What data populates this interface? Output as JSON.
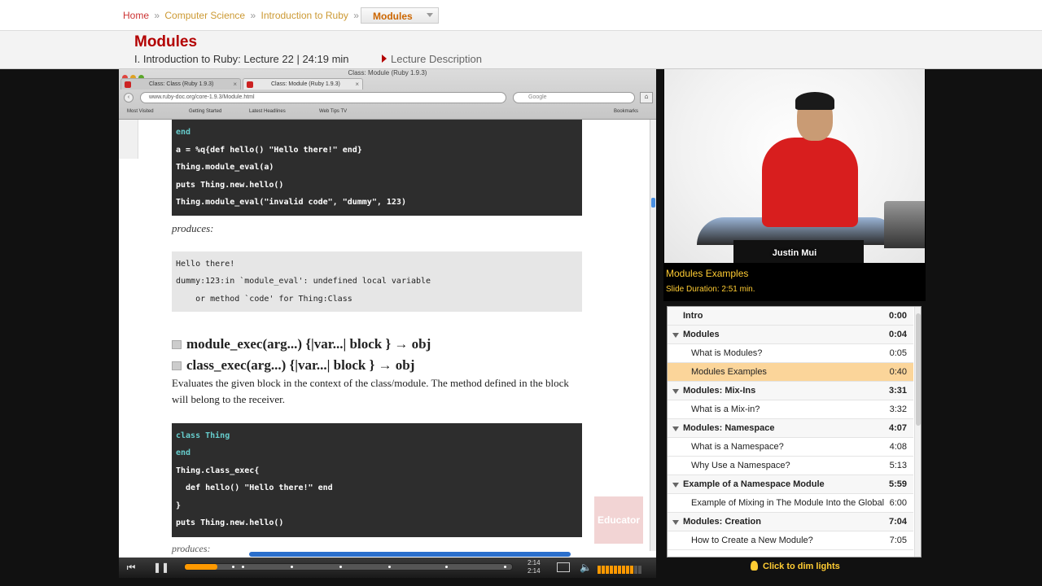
{
  "breadcrumb": {
    "home": "Home",
    "sep": "»",
    "level1": "Computer Science",
    "level2": "Introduction to Ruby",
    "current": "Modules"
  },
  "header": {
    "title": "Modules",
    "subtitle": "I. Introduction to Ruby: Lecture 22 | 24:19 min",
    "description_link": "Lecture Description"
  },
  "browser": {
    "window_title": "Class: Module (Ruby 1.9.3)",
    "tabs": [
      {
        "label": "Class: Class (Ruby 1.9.3)"
      },
      {
        "label": "Class: Module (Ruby 1.9.3)"
      }
    ],
    "url": "www.ruby-doc.org/core-1.9.3/Module.html",
    "search_placeholder": "Google",
    "bookmarks": [
      "Most Visited",
      "Getting Started",
      "Latest Headlines",
      "Web Tips TV",
      "Bookmarks"
    ]
  },
  "doc": {
    "code1": [
      "end",
      "a = %q{def hello() \"Hello there!\" end}",
      "Thing.module_eval(a)",
      "puts Thing.new.hello()",
      "Thing.module_eval(\"invalid code\", \"dummy\", 123)"
    ],
    "produces": "produces:",
    "output": [
      "Hello there!",
      "dummy:123:in `module_eval': undefined local variable",
      "    or method `code' for Thing:Class"
    ],
    "method1": "module_exec(arg...) {|var...| block } → obj",
    "method2": "class_exec(arg...) {|var...| block } → obj",
    "paragraph": "Evaluates the given block in the context of the class/module. The method defined in the block will belong to the receiver.",
    "code2": [
      "class Thing",
      "end",
      "Thing.class_exec{",
      "  def hello() \"Hello there!\" end",
      "}",
      "puts Thing.new.hello()"
    ],
    "produces_cut": "produces:",
    "watermark": "Educator"
  },
  "player": {
    "progress_fraction": 0.1,
    "time_current": "2:14",
    "time_total": "2:14",
    "volume_level": 0.85
  },
  "presenter": {
    "name": "Justin Mui",
    "slide_title": "Modules Examples",
    "slide_duration": "Slide Duration: 2:51 min."
  },
  "toc": [
    {
      "type": "top",
      "label": "Intro",
      "time": "0:00"
    },
    {
      "type": "sec",
      "label": "Modules",
      "time": "0:04"
    },
    {
      "type": "sub",
      "label": "What is Modules?",
      "time": "0:05"
    },
    {
      "type": "sub-active",
      "label": "Modules Examples",
      "time": "0:40"
    },
    {
      "type": "sec",
      "label": "Modules: Mix-Ins",
      "time": "3:31"
    },
    {
      "type": "sub",
      "label": "What is a Mix-in?",
      "time": "3:32"
    },
    {
      "type": "sec",
      "label": "Modules: Namespace",
      "time": "4:07"
    },
    {
      "type": "sub",
      "label": "What is a Namespace?",
      "time": "4:08"
    },
    {
      "type": "sub",
      "label": "Why Use a Namespace?",
      "time": "5:13"
    },
    {
      "type": "sec",
      "label": "Example of a Namespace Module",
      "time": "5:59"
    },
    {
      "type": "sub",
      "label": "Example of Mixing in The Module Into the Global",
      "time": "6:00"
    },
    {
      "type": "sec",
      "label": "Modules: Creation",
      "time": "7:04"
    },
    {
      "type": "sub",
      "label": "How to Create a New Module?",
      "time": "7:05"
    }
  ],
  "dim_lights": "Click to dim lights",
  "colors": {
    "accent": "#b30000",
    "highlight": "#fbd59a",
    "gold": "#ffcc33"
  }
}
